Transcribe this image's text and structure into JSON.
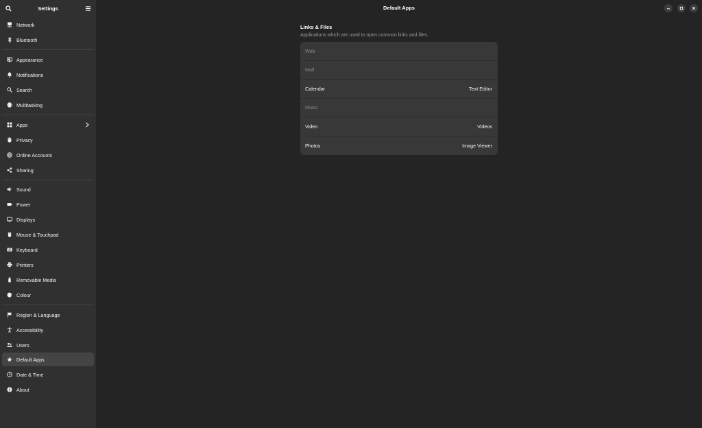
{
  "sidebar": {
    "title": "Settings",
    "items": [
      {
        "label": "Network",
        "icon": "network-icon"
      },
      {
        "label": "Bluetooth",
        "icon": "bluetooth-icon"
      },
      {
        "label": "Appearance",
        "icon": "appearance-icon"
      },
      {
        "label": "Notifications",
        "icon": "bell-icon"
      },
      {
        "label": "Search",
        "icon": "search-icon"
      },
      {
        "label": "Multitasking",
        "icon": "multitasking-icon"
      },
      {
        "label": "Apps",
        "icon": "apps-grid-icon"
      },
      {
        "label": "Privacy",
        "icon": "hand-icon"
      },
      {
        "label": "Online Accounts",
        "icon": "at-icon"
      },
      {
        "label": "Sharing",
        "icon": "share-icon"
      },
      {
        "label": "Sound",
        "icon": "speaker-icon"
      },
      {
        "label": "Power",
        "icon": "battery-icon"
      },
      {
        "label": "Displays",
        "icon": "monitor-icon"
      },
      {
        "label": "Mouse & Touchpad",
        "icon": "mouse-icon"
      },
      {
        "label": "Keyboard",
        "icon": "keyboard-icon"
      },
      {
        "label": "Printers",
        "icon": "printer-icon"
      },
      {
        "label": "Removable Media",
        "icon": "usb-icon"
      },
      {
        "label": "Colour",
        "icon": "colour-icon"
      },
      {
        "label": "Region & Language",
        "icon": "flag-icon"
      },
      {
        "label": "Accessibility",
        "icon": "accessibility-icon"
      },
      {
        "label": "Users",
        "icon": "users-icon"
      },
      {
        "label": "Default Apps",
        "icon": "star-icon"
      },
      {
        "label": "Date & Time",
        "icon": "clock-icon"
      },
      {
        "label": "About",
        "icon": "info-icon"
      }
    ],
    "active_item": "Default Apps"
  },
  "header": {
    "title": "Default Apps"
  },
  "section": {
    "title": "Links & Files",
    "subtitle": "Applications which are used to open common links and files."
  },
  "rows": [
    {
      "label": "Web",
      "value": ""
    },
    {
      "label": "Mail",
      "value": ""
    },
    {
      "label": "Calendar",
      "value": "Text Editor"
    },
    {
      "label": "Music",
      "value": ""
    },
    {
      "label": "Video",
      "value": "Videos"
    },
    {
      "label": "Photos",
      "value": "Image Viewer"
    }
  ],
  "colors": {
    "background": "#242424",
    "sidebar": "#303030",
    "card": "#383838",
    "active": "#444444"
  }
}
